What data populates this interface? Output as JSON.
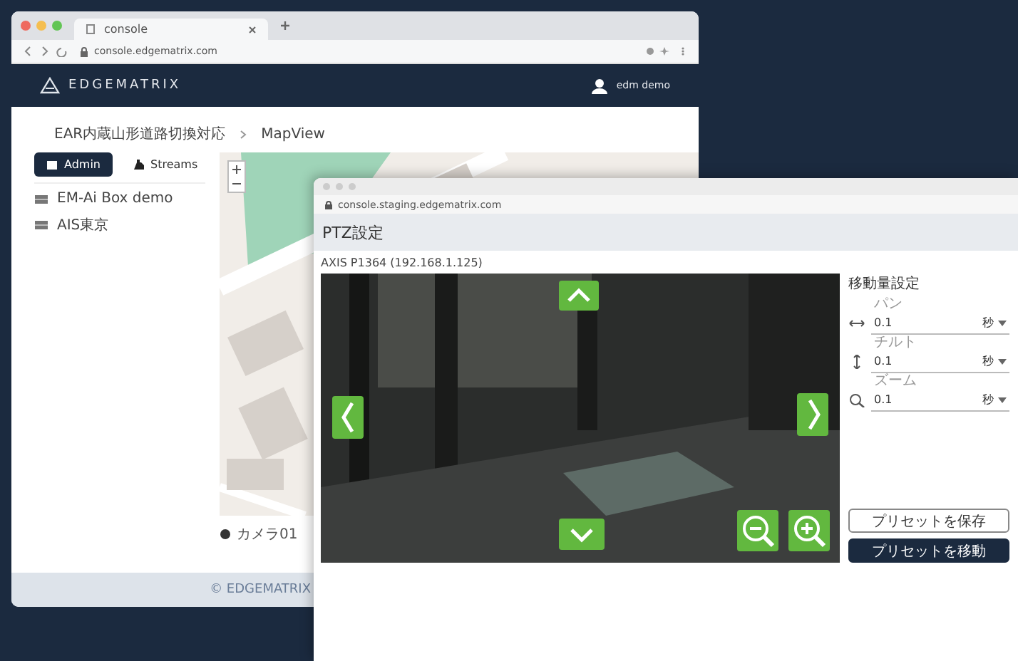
{
  "console_window": {
    "tab_title": "console",
    "url": "console.edgematrix.com",
    "brand": "EDGEMATRIX",
    "user": "edm demo",
    "breadcrumb": [
      "EAR内蔵山形道路切換対応",
      "MapView"
    ],
    "sidebar_tabs": [
      {
        "label": "Admin",
        "selected": true
      },
      {
        "label": "Streams",
        "selected": false
      }
    ],
    "sidebar_items": [
      "EM-Ai Box demo",
      "AIS東京"
    ],
    "map_legend": "カメラ01",
    "footer": "© EDGEMATRIX"
  },
  "ptz_window": {
    "url": "console.staging.edgematrix.com",
    "title": "PTZ設定",
    "camera": "AXIS P1364 (192.168.1.125)",
    "settings_title": "移動量設定",
    "settings": [
      {
        "kind": "pan",
        "label": "パン",
        "value": "0.1",
        "unit": "秒"
      },
      {
        "kind": "tilt",
        "label": "チルト",
        "value": "0.1",
        "unit": "秒"
      },
      {
        "kind": "zoom",
        "label": "ズーム",
        "value": "0.1",
        "unit": "秒"
      }
    ],
    "buttons": [
      {
        "kind": "outline",
        "label": "プリセットを保存"
      },
      {
        "kind": "filled",
        "label": "プリセットを移動"
      }
    ]
  }
}
